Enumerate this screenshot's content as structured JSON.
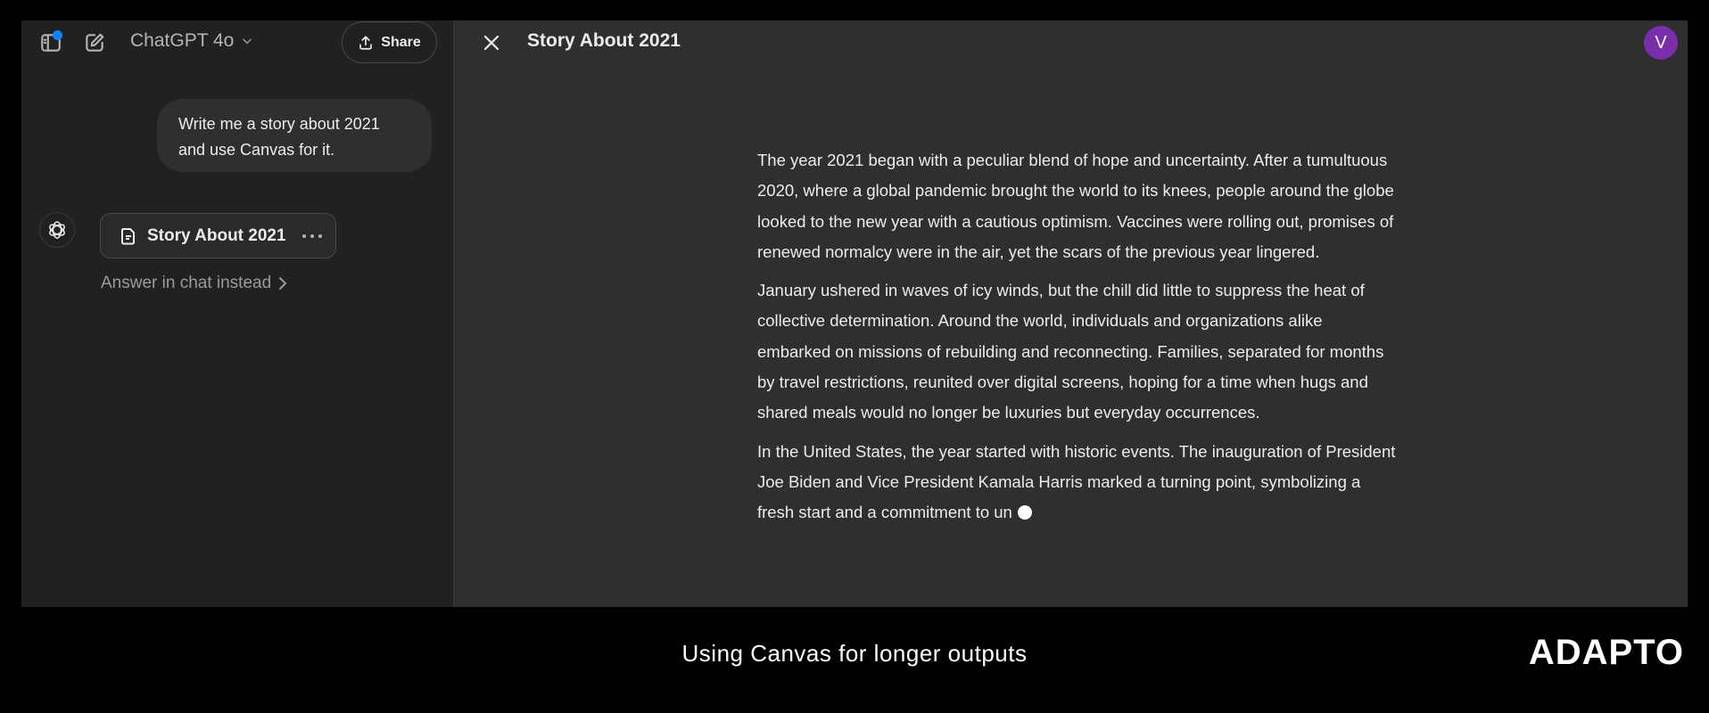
{
  "chat": {
    "model_name": "ChatGPT 4o",
    "share_label": "Share",
    "user_message": "Write me a story about 2021 and use Canvas for it.",
    "canvas_card_title": "Story About 2021",
    "answer_in_chat_label": "Answer in chat instead"
  },
  "canvas": {
    "title": "Story About 2021",
    "user_avatar_initial": "V",
    "paragraphs": [
      "The year 2021 began with a peculiar blend of hope and uncertainty. After a tumultuous 2020, where a global pandemic brought the world to its knees, people around the globe looked to the new year with a cautious optimism. Vaccines were rolling out, promises of renewed normalcy were in the air, yet the scars of the previous year lingered.",
      "January ushered in waves of icy winds, but the chill did little to suppress the heat of collective determination. Around the world, individuals and organizations alike embarked on missions of rebuilding and reconnecting. Families, separated for months by travel restrictions, reunited over digital screens, hoping for a time when hugs and shared meals would no longer be luxuries but everyday occurrences.",
      "In the United States, the year started with historic events. The inauguration of President Joe Biden and Vice President Kamala Harris marked a turning point, symbolizing a fresh start and a commitment to un"
    ]
  },
  "colors": {
    "notification_dot": "#0a84ff",
    "avatar_bg": "#7b2eaa"
  },
  "footer": {
    "caption": "Using Canvas for longer outputs",
    "brand": "ADAPTO"
  }
}
